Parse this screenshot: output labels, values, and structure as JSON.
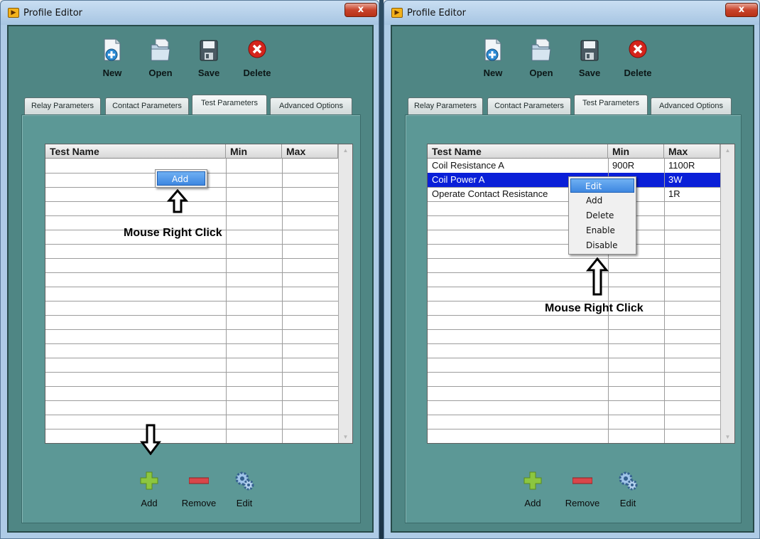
{
  "windows": [
    {
      "title": "Profile Editor",
      "close_label": "x",
      "toolbar": {
        "new": "New",
        "open": "Open",
        "save": "Save",
        "delete": "Delete"
      },
      "tabs": [
        "Relay Parameters",
        "Contact Parameters",
        "Test Parameters",
        "Advanced Options"
      ],
      "active_tab": "Test Parameters",
      "table": {
        "headers": [
          "Test Name",
          "Min",
          "Max"
        ],
        "rows": []
      },
      "context_menu": [
        "Add"
      ],
      "annotation": "Mouse Right Click",
      "bottom": {
        "add": "Add",
        "remove": "Remove",
        "edit": "Edit"
      }
    },
    {
      "title": "Profile Editor",
      "close_label": "x",
      "toolbar": {
        "new": "New",
        "open": "Open",
        "save": "Save",
        "delete": "Delete"
      },
      "tabs": [
        "Relay Parameters",
        "Contact Parameters",
        "Test Parameters",
        "Advanced Options"
      ],
      "active_tab": "Test Parameters",
      "table": {
        "headers": [
          "Test Name",
          "Min",
          "Max"
        ],
        "rows": [
          [
            "Coil Resistance A",
            "900R",
            "1100R"
          ],
          [
            "Coil Power A",
            "",
            "3W"
          ],
          [
            "Operate Contact Resistance",
            "",
            "1R"
          ]
        ],
        "selected_row": 1
      },
      "context_menu": [
        "Edit",
        "Add",
        "Delete",
        "Enable",
        "Disable"
      ],
      "context_highlight": "Edit",
      "annotation": "Mouse Right Click",
      "bottom": {
        "add": "Add",
        "remove": "Remove",
        "edit": "Edit"
      }
    }
  ],
  "colors": {
    "panel": "#4f8684",
    "tab_page": "#5c9896",
    "selection": "#0a1fd8",
    "titlebar": "#aecbe6"
  },
  "icons": [
    "new-document-icon",
    "open-folder-icon",
    "floppy-save-icon",
    "delete-x-icon",
    "plus-icon",
    "minus-icon",
    "gears-icon",
    "outline-up-arrow-icon",
    "outline-down-arrow-icon"
  ]
}
